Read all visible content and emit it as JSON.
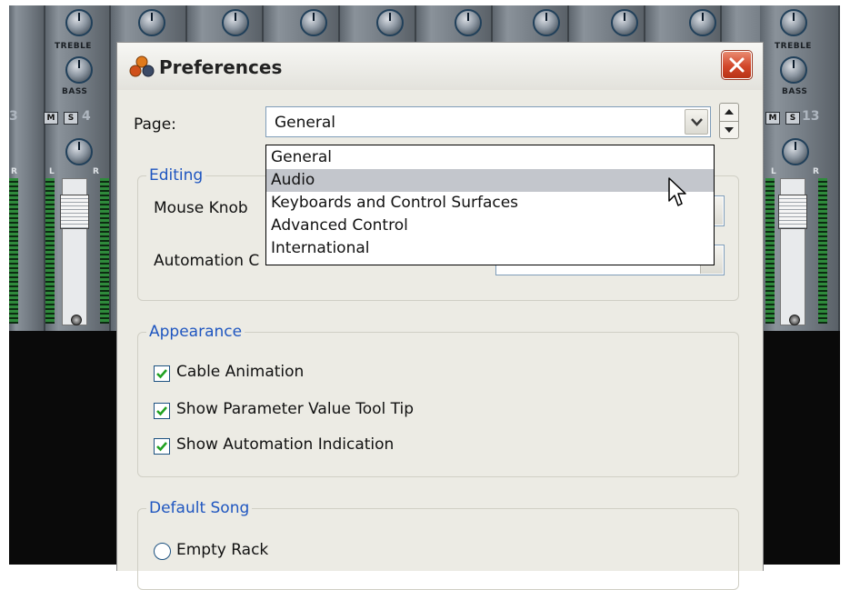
{
  "mixer": {
    "knob_labels": {
      "treble": "TREBLE",
      "bass": "BASS"
    },
    "mute_label": "M",
    "solo_label": "S",
    "channel_numbers": [
      "3",
      "4",
      "13"
    ],
    "left_label": "L",
    "right_label": "R"
  },
  "dialog": {
    "title": "Preferences",
    "close_icon": "close-icon"
  },
  "page_selector": {
    "label": "Page:",
    "value": "General",
    "options": [
      "General",
      "Audio",
      "Keyboards and Control Surfaces",
      "Advanced Control",
      "International"
    ],
    "highlighted_option": "Audio"
  },
  "editing": {
    "title": "Editing",
    "mouse_knob_label": "Mouse Knob",
    "automation_label": "Automation C"
  },
  "appearance": {
    "title": "Appearance",
    "options": [
      {
        "label": "Cable Animation",
        "checked": true
      },
      {
        "label": "Show Parameter Value Tool Tip",
        "checked": true
      },
      {
        "label": "Show Automation Indication",
        "checked": true
      }
    ]
  },
  "default_song": {
    "title": "Default Song",
    "options": [
      {
        "label": "Empty Rack",
        "selected": false
      }
    ]
  },
  "colors": {
    "group_title": "#1f56c0",
    "dialog_bg": "#ecebe4",
    "close_button": "#d2472a",
    "checkmark": "#21a121",
    "highlight": "#c3c6cc"
  }
}
